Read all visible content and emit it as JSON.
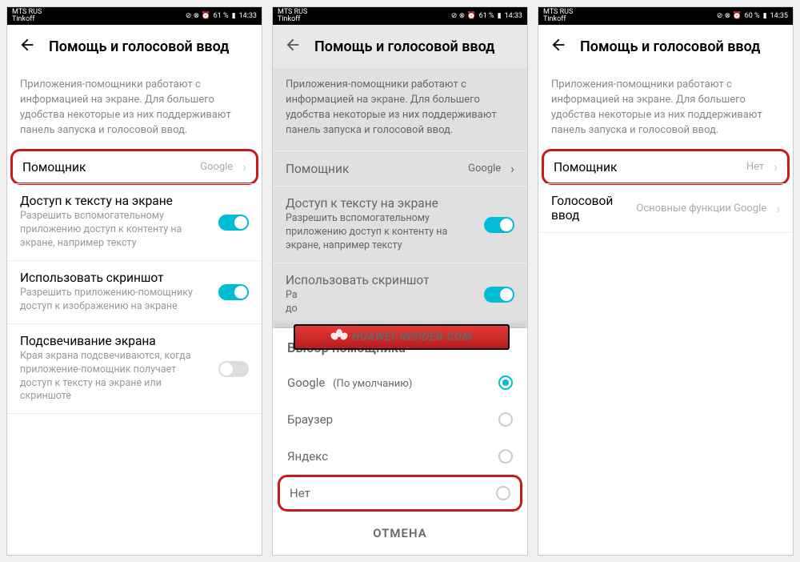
{
  "status": {
    "carrier1": "MTS RUS",
    "carrier2": "Tinkoff",
    "icons": "⊘ ⊗ ⏰",
    "battery_a": "61 %",
    "battery_c": "60 %",
    "time_a": "14:33",
    "time_c": "14:35"
  },
  "header": {
    "title": "Помощь и голосовой ввод"
  },
  "desc": "Приложения-помощники работают с информацией на экране. Для большего удобства некоторые из них поддерживают панель запуска и голосовой ввод.",
  "rows": {
    "assistant": {
      "title": "Помощник",
      "value_google": "Google",
      "value_none": "Нет"
    },
    "text_access": {
      "title": "Доступ к тексту на экране",
      "sub": "Разрешить вспомогательному приложению доступ к контенту на экране, например тексту"
    },
    "screenshot": {
      "title": "Использовать скриншот",
      "sub": "Разрешить приложению-помощнику доступ к изображению на экране",
      "sub_short": "Ра\nдо"
    },
    "highlight": {
      "title": "Подсвечивание экрана",
      "sub": "Края экрана подсвечиваются, когда приложение-помощник получает доступ к тексту на экране или скриншоте"
    },
    "voice_input": {
      "title": "Голосовой ввод",
      "value": "Основные функции Google"
    }
  },
  "sheet": {
    "title": "Выбор помощника",
    "options": {
      "google": "Google",
      "google_default": "(По умолчанию)",
      "browser": "Браузер",
      "yandex": "Яндекс",
      "none": "Нет"
    },
    "cancel": "ОТМЕНА"
  },
  "watermark": "HUAWEI-INSIDER.COM"
}
